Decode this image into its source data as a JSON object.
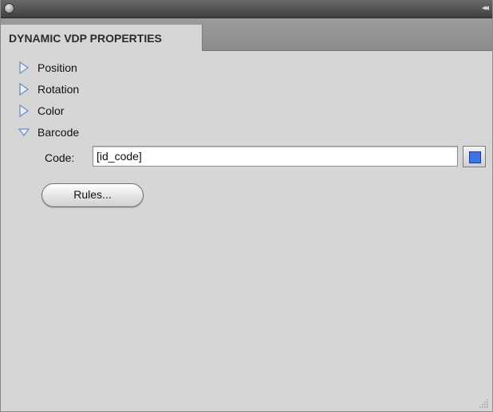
{
  "panel": {
    "tab_title": "DYNAMIC VDP PROPERTIES",
    "close_icon": "close-icon",
    "collapse_icon": "double-chevron-collapse-icon",
    "collapse_glyph": "◂◂"
  },
  "sections": [
    {
      "label": "Position",
      "expanded": false,
      "icon": "disclosure-collapsed-icon"
    },
    {
      "label": "Rotation",
      "expanded": false,
      "icon": "disclosure-collapsed-icon"
    },
    {
      "label": "Color",
      "expanded": false,
      "icon": "disclosure-collapsed-icon"
    },
    {
      "label": "Barcode",
      "expanded": true,
      "icon": "disclosure-expanded-icon"
    }
  ],
  "barcode": {
    "code_label": "Code:",
    "code_value": "[id_code]",
    "swatch_color": "#3f73e6",
    "rules_button_label": "Rules..."
  },
  "colors": {
    "panel_bg": "#d6d6d6",
    "titlebar_bg": "#4a4a4a",
    "disclosure_outline": "#6d8fc2"
  }
}
